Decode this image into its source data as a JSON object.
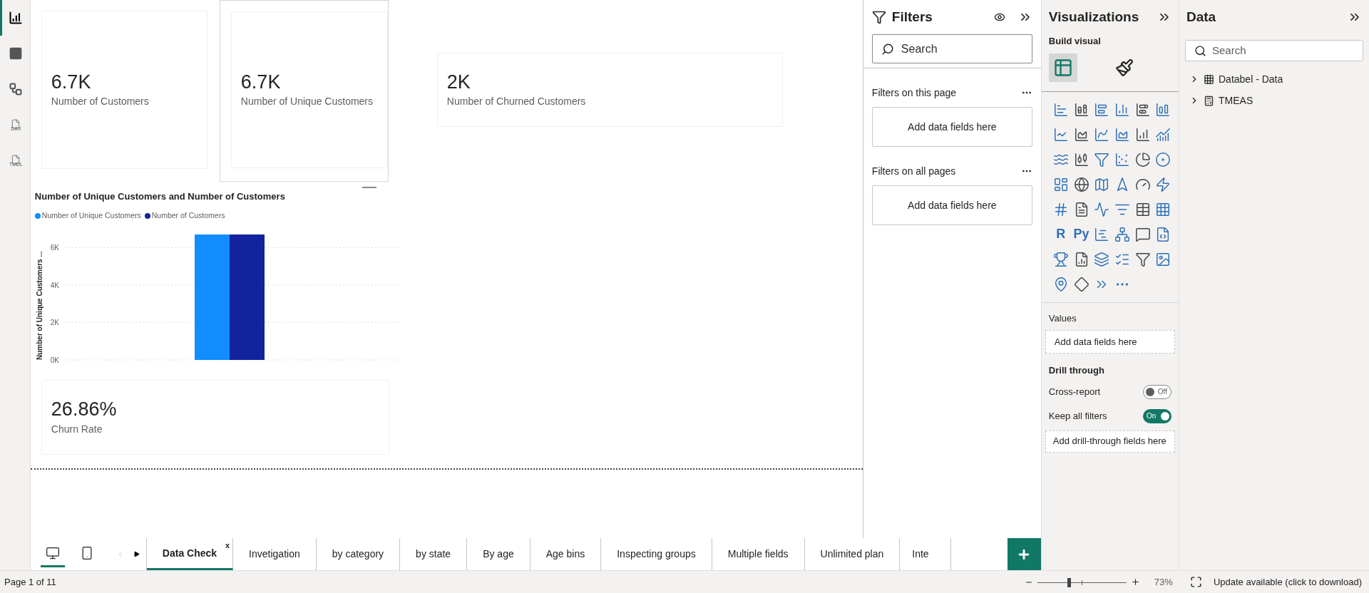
{
  "view_switcher": [
    {
      "kind": "report",
      "selected": true
    },
    {
      "kind": "table",
      "selected": false
    },
    {
      "kind": "model",
      "selected": false
    },
    {
      "kind": "dax",
      "label": "DAX",
      "selected": false
    },
    {
      "kind": "tmdl",
      "label": "TMDL",
      "selected": false
    }
  ],
  "canvas": {
    "cards": [
      {
        "value": "6.7K",
        "label": "Number of Customers",
        "selected": false
      },
      {
        "value": "6.7K",
        "label": "Number of Unique Customers",
        "selected": true
      },
      {
        "value": "2K",
        "label": "Number of Churned Customers",
        "selected": false
      },
      {
        "value": "26.86%",
        "label": "Churn Rate",
        "selected": false
      }
    ],
    "chart_data": {
      "type": "bar",
      "grid": true,
      "legend": "top-left",
      "title": "Number of Unique Customers and Number of Customers",
      "ylabel": "Number of Unique Customers ...",
      "ylim": [
        0,
        6700
      ],
      "yticks": [
        {
          "value": 0,
          "label": "0K"
        },
        {
          "value": 2000,
          "label": "2K"
        },
        {
          "value": 4000,
          "label": "4K"
        },
        {
          "value": 6000,
          "label": "6K"
        }
      ],
      "series": [
        {
          "name": "Number of Unique Customers",
          "color": "#118dff",
          "values": [
            6700
          ]
        },
        {
          "name": "Number of Customers",
          "color": "#12239e",
          "values": [
            6700
          ]
        }
      ]
    }
  },
  "filters": {
    "title": "Filters",
    "search_placeholder": "Search",
    "sections": [
      {
        "heading": "Filters on this page",
        "drop_zone": "Add data fields here"
      },
      {
        "heading": "Filters on all pages",
        "drop_zone": "Add data fields here"
      }
    ]
  },
  "visualizations": {
    "title": "Visualizations",
    "build_label": "Build visual",
    "modes": [
      {
        "kind": "build",
        "selected": true
      },
      {
        "kind": "format",
        "selected": false
      }
    ],
    "script_visuals": [
      "R",
      "Py"
    ],
    "values_heading": "Values",
    "values_drop_zone": "Add data fields here",
    "drill_heading": "Drill through",
    "toggles": [
      {
        "label": "Cross-report",
        "on": false,
        "state_text": "Off"
      },
      {
        "label": "Keep all filters",
        "on": true,
        "state_text": "On"
      }
    ],
    "drill_drop_zone": "Add drill-through fields here"
  },
  "data": {
    "title": "Data",
    "search_placeholder": "Search",
    "tables": [
      {
        "name": "Databel - Data",
        "kind": "table",
        "expanded": false
      },
      {
        "name": "TMEAS",
        "kind": "measures",
        "expanded": false
      }
    ]
  },
  "page_tabs": {
    "views": [
      {
        "kind": "desktop",
        "selected": true
      },
      {
        "kind": "phone",
        "selected": false
      }
    ],
    "tabs": [
      {
        "label": "Data Check",
        "selected": true,
        "close": "x"
      },
      {
        "label": "Invetigation",
        "selected": false
      },
      {
        "label": "by category",
        "selected": false
      },
      {
        "label": "by state",
        "selected": false
      },
      {
        "label": "By age",
        "selected": false
      },
      {
        "label": "Age bins",
        "selected": false
      },
      {
        "label": "Inspecting groups",
        "selected": false
      },
      {
        "label": "Multiple fields",
        "selected": false
      },
      {
        "label": "Unlimited plan",
        "selected": false
      },
      {
        "label": "Inte",
        "selected": false
      }
    ]
  },
  "status_bar": {
    "page": "Page 1 of 11",
    "zoom_slider": {
      "level": 0.35
    },
    "zoom_reading": "73%",
    "update": "Update available (click to download)"
  }
}
